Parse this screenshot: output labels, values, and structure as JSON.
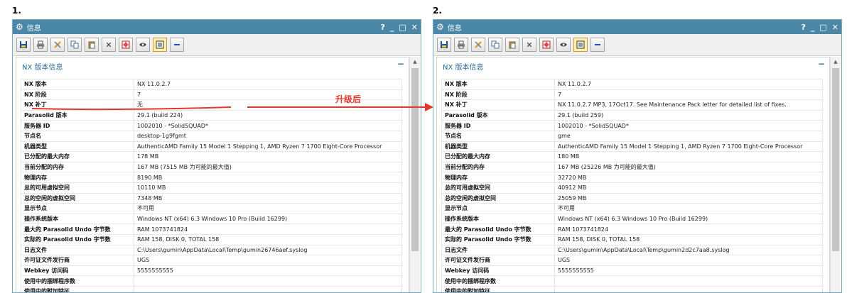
{
  "steps": [
    "1.",
    "2."
  ],
  "annotation": "升级后",
  "arrow_color": "#e03a2c",
  "windows": [
    {
      "title": "信息",
      "title_icon": "gear-icon",
      "title_buttons": [
        "?",
        "_",
        "□",
        "✕"
      ],
      "section_title": "NX 版本信息",
      "collapse_symbol": "−",
      "rows": [
        {
          "k": "NX 版本",
          "v": "NX 11.0.2.7"
        },
        {
          "k": "NX 阶段",
          "v": "7"
        },
        {
          "k": "NX 补丁",
          "v": "无"
        },
        {
          "k": "Parasolid 版本",
          "v": "29.1 (build 224)"
        },
        {
          "k": "服务器 ID",
          "v": "1002010 - *SolidSQUAD*"
        },
        {
          "k": "节点名",
          "v": "desktop-1g9fgmt"
        },
        {
          "k": "机器类型",
          "v": "AuthenticAMD Family 15 Model 1 Stepping 1, AMD Ryzen 7 1700 Eight-Core Processor"
        },
        {
          "k": "已分配的最大内存",
          "v": "178 MB"
        },
        {
          "k": "当前分配的内存",
          "v": "167 MB (7515 MB 为可能的最大值)"
        },
        {
          "k": "物理内存",
          "v": "8190 MB"
        },
        {
          "k": "总的可用虚拟空间",
          "v": "10110 MB"
        },
        {
          "k": "总的空闲的虚拟空间",
          "v": "7348 MB"
        },
        {
          "k": "显示节点",
          "v": "不可用"
        },
        {
          "k": "操作系统版本",
          "v": "Windows NT (x64) 6.3 Windows 10 Pro (Build 16299)"
        },
        {
          "k": "最大的 Parasolid Undo 字节数",
          "v": "RAM 1073741824"
        },
        {
          "k": "实际的 Parasolid Undo 字节数",
          "v": "RAM 158, DISK 0, TOTAL 158"
        },
        {
          "k": "日志文件",
          "v": "C:\\Users\\gumin\\AppData\\Local\\Temp\\gumin26746aef.syslog"
        },
        {
          "k": "许可证文件发行商",
          "v": "UGS"
        },
        {
          "k": "Webkey 访问码",
          "v": "5555555555"
        },
        {
          "k": "使用中的捆绑程序数",
          "v": ""
        },
        {
          "k": "使用中的附加特征",
          "v": ""
        }
      ]
    },
    {
      "title": "信息",
      "title_icon": "gear-icon",
      "title_buttons": [
        "?",
        "_",
        "□",
        "✕"
      ],
      "section_title": "NX 版本信息",
      "collapse_symbol": "−",
      "rows": [
        {
          "k": "NX 版本",
          "v": "NX 11.0.2.7"
        },
        {
          "k": "NX 阶段",
          "v": "7"
        },
        {
          "k": "NX 补丁",
          "v": "NX 11.0.2.7 MP3, 17Oct17. See Maintenance Pack letter for detailed list of fixes."
        },
        {
          "k": "Parasolid 版本",
          "v": "29.1 (build 259)"
        },
        {
          "k": "服务器 ID",
          "v": "1002010 - *SolidSQUAD*"
        },
        {
          "k": "节点名",
          "v": "gme"
        },
        {
          "k": "机器类型",
          "v": "AuthenticAMD Family 15 Model 1 Stepping 1, AMD Ryzen 7 1700 Eight-Core Processor"
        },
        {
          "k": "已分配的最大内存",
          "v": "180 MB"
        },
        {
          "k": "当前分配的内存",
          "v": "167 MB (25226 MB 为可能的最大值)"
        },
        {
          "k": "物理内存",
          "v": "32720 MB"
        },
        {
          "k": "总的可用虚拟空间",
          "v": "40912 MB"
        },
        {
          "k": "总的空闲的虚拟空间",
          "v": "25059 MB"
        },
        {
          "k": "显示节点",
          "v": "不可用"
        },
        {
          "k": "操作系统版本",
          "v": "Windows NT (x64) 6.3 Windows 10 Pro (Build 16299)"
        },
        {
          "k": "最大的 Parasolid Undo 字节数",
          "v": "RAM 1073741824"
        },
        {
          "k": "实际的 Parasolid Undo 字节数",
          "v": "RAM 158, DISK 0, TOTAL 158"
        },
        {
          "k": "日志文件",
          "v": "C:\\Users\\gumin\\AppData\\Local\\Temp\\gumin2d2c7aa8.syslog"
        },
        {
          "k": "许可证文件发行商",
          "v": "UGS"
        },
        {
          "k": "Webkey 访问码",
          "v": "5555555555"
        },
        {
          "k": "使用中的捆绑程序数",
          "v": ""
        },
        {
          "k": "使用中的附加特征",
          "v": ""
        }
      ]
    }
  ],
  "toolbar_icons": [
    "save-icon",
    "print-icon",
    "tools-icon",
    "copy-icon",
    "paste-icon",
    "close-icon",
    "crosshair-icon",
    "view-icon",
    "report-icon",
    "minimize-icon"
  ]
}
